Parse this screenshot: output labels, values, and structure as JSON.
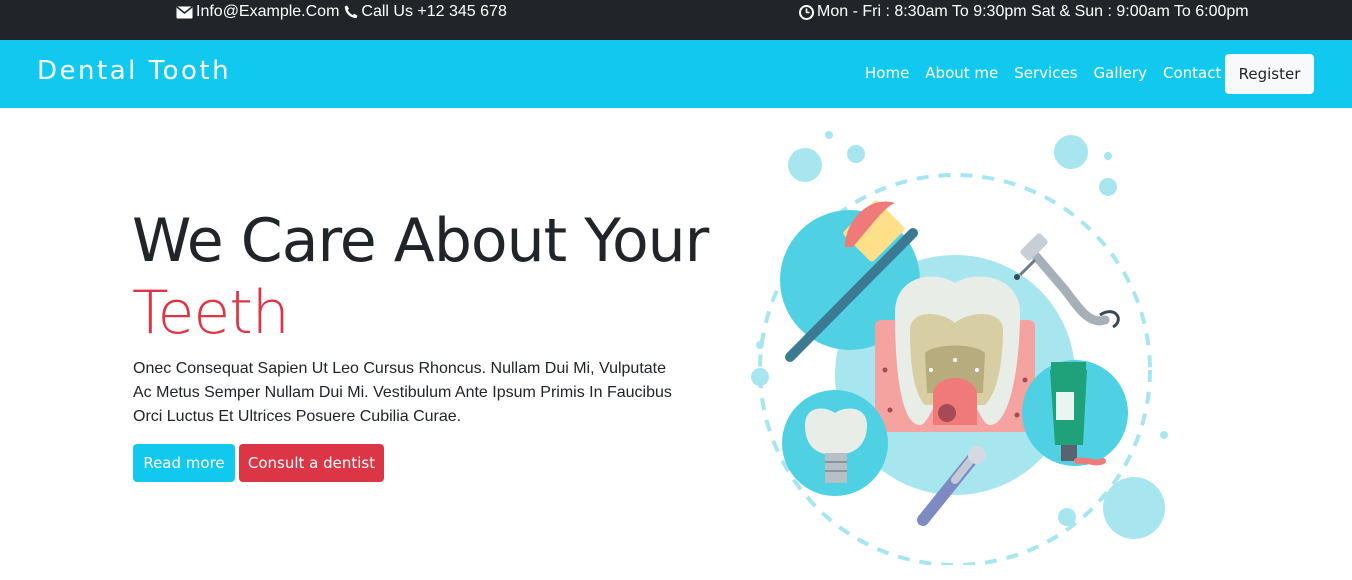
{
  "topbar": {
    "email": "Info@Example.Com",
    "phone": "Call Us +12 345 678",
    "hours": "Mon - Fri : 8:30am To 9:30pm Sat & Sun : 9:00am To 6:00pm"
  },
  "navbar": {
    "brand": "Dental Tooth",
    "links": [
      "Home",
      "About me",
      "Services",
      "Gallery",
      "Contact"
    ],
    "register_label": "Register"
  },
  "hero": {
    "title_line1": "We Care About Your",
    "title_line2": "Teeth",
    "text": "Onec Consequat Sapien Ut Leo Cursus Rhoncus. Nullam Dui Mi, Vulputate Ac Metus Semper Nullam Dui Mi. Vestibulum Ante Ipsum Primis In Faucibus Orci Luctus Et Ultrices Posuere Cubilia Curae.",
    "read_more_label": "Read more",
    "consult_label": "Consult a dentist"
  },
  "colors": {
    "accent": "#11c9ef",
    "danger": "#dc3545",
    "topbar": "#212529"
  }
}
